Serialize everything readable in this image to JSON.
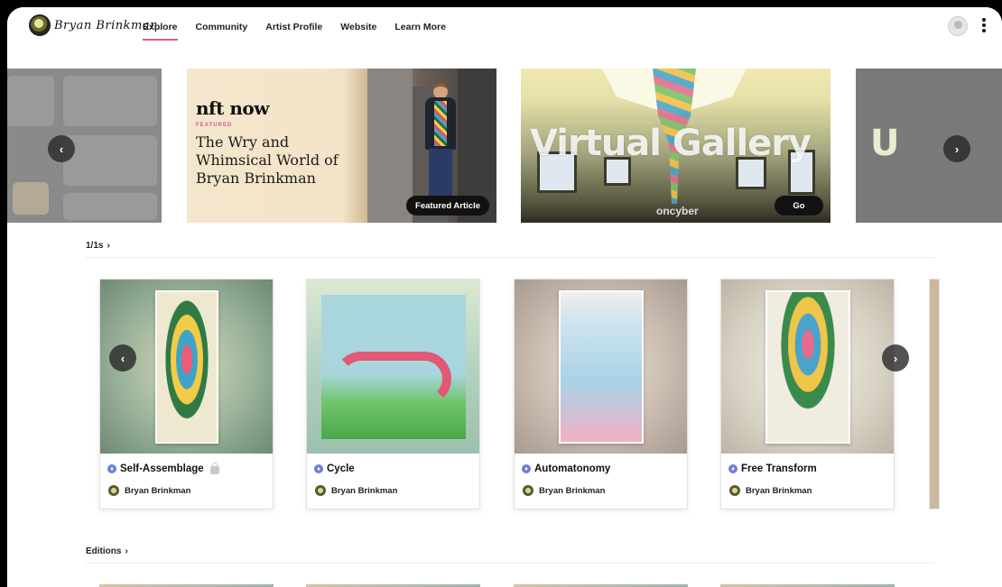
{
  "header": {
    "logo_text": "Bryan Brinkman",
    "nav": [
      {
        "label": "Explore",
        "active": true
      },
      {
        "label": "Community",
        "active": false
      },
      {
        "label": "Artist Profile",
        "active": false
      },
      {
        "label": "Website",
        "active": false
      },
      {
        "label": "Learn More",
        "active": false
      }
    ],
    "accent_color": "#e05a8a"
  },
  "banners": {
    "article": {
      "publisher": "nft now",
      "tag": "FEATURED",
      "title": "The Wry and Whimsical World of Bryan Brinkman",
      "button": "Featured Article"
    },
    "gallery": {
      "title": "Virtual Gallery",
      "brand": "oncyber",
      "button": "Go"
    },
    "right": {
      "title": "U"
    },
    "prev_icon": "chevron-left-icon",
    "next_icon": "chevron-right-icon"
  },
  "sections": {
    "ones": {
      "title": "1/1s",
      "chevron": "›"
    },
    "editions": {
      "title": "Editions",
      "chevron": "›"
    }
  },
  "cards": [
    {
      "title": "Self-Assemblage",
      "artist": "Bryan Brinkman",
      "locked": true
    },
    {
      "title": "Cycle",
      "artist": "Bryan Brinkman",
      "locked": false
    },
    {
      "title": "Automatonomy",
      "artist": "Bryan Brinkman",
      "locked": false
    },
    {
      "title": "Free Transform",
      "artist": "Bryan Brinkman",
      "locked": false
    }
  ],
  "icons": {
    "prev": "‹",
    "next": "›",
    "eth": "♦"
  }
}
